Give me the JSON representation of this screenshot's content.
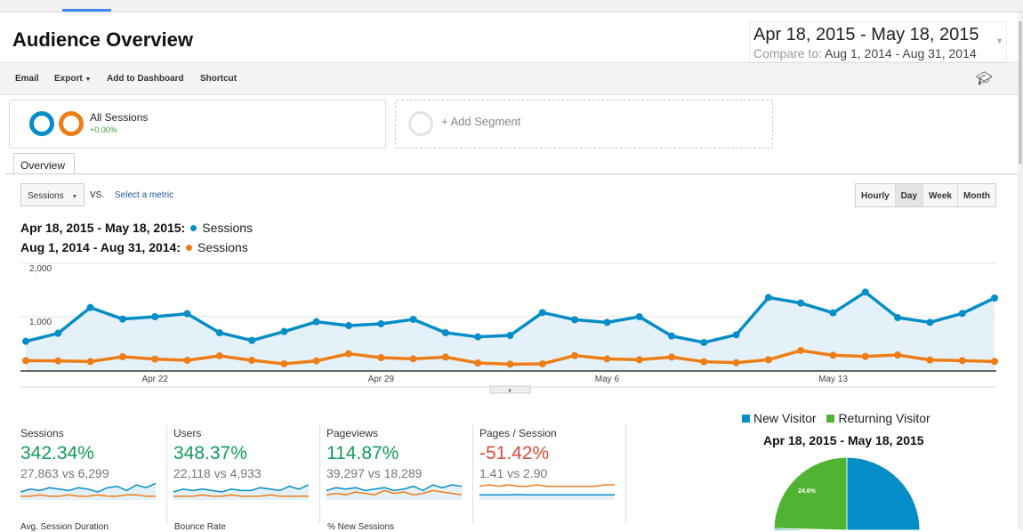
{
  "header": {
    "title": "Audience Overview",
    "date_range": "Apr 18, 2015 - May 18, 2015",
    "compare_label": "Compare to:",
    "compare_range": "Aug 1, 2014 - Aug 31, 2014"
  },
  "toolbar": {
    "email": "Email",
    "export": "Export",
    "add_dashboard": "Add to Dashboard",
    "shortcut": "Shortcut",
    "icon": "graduation-cap-icon"
  },
  "segments": {
    "all_sessions": "All Sessions",
    "all_sessions_change": "+0.00%",
    "add_segment": "+ Add Segment"
  },
  "tabs": [
    "Overview"
  ],
  "controls": {
    "metric": "Sessions",
    "vs": "VS.",
    "select_metric": "Select a metric",
    "granularity": [
      "Hourly",
      "Day",
      "Week",
      "Month"
    ],
    "selected": "Day"
  },
  "legend": [
    {
      "range": "Apr 18, 2015 - May 18, 2015:",
      "metric": "Sessions",
      "color": "#058dc7"
    },
    {
      "range": "Aug 1, 2014 - Aug 31, 2014:",
      "metric": "Sessions",
      "color": "#ed7e17"
    }
  ],
  "chart_data": [
    {
      "type": "line",
      "x_ticks": [
        "Apr 22",
        "Apr 29",
        "May 6",
        "May 13"
      ],
      "y_ticks": [
        "2,000",
        "1,000"
      ],
      "ylim": [
        0,
        2000
      ],
      "grid": true,
      "x": [
        "Apr 18",
        "Apr 19",
        "Apr 20",
        "Apr 21",
        "Apr 22",
        "Apr 23",
        "Apr 24",
        "Apr 25",
        "Apr 26",
        "Apr 27",
        "Apr 28",
        "Apr 29",
        "Apr 30",
        "May 1",
        "May 2",
        "May 3",
        "May 4",
        "May 5",
        "May 6",
        "May 7",
        "May 8",
        "May 9",
        "May 10",
        "May 11",
        "May 12",
        "May 13",
        "May 14",
        "May 15",
        "May 16",
        "May 17",
        "May 18"
      ],
      "series": [
        {
          "name": "Sessions",
          "color": "#058dc7",
          "values": [
            539,
            689,
            1172,
            956,
            1000,
            1056,
            700,
            556,
            722,
            906,
            833,
            867,
            950,
            700,
            622,
            650,
            1078,
            944,
            894,
            1000,
            639,
            517,
            661,
            1361,
            1256,
            1072,
            1461,
            983,
            894,
            1061,
            1350
          ]
        },
        {
          "name": "Sessions",
          "color": "#ed7e17",
          "values": [
            178,
            172,
            161,
            250,
            206,
            183,
            267,
            183,
            117,
            172,
            306,
            233,
            211,
            244,
            133,
            111,
            117,
            272,
            211,
            194,
            244,
            156,
            139,
            194,
            367,
            278,
            256,
            283,
            189,
            178,
            161
          ]
        }
      ]
    },
    {
      "type": "pie",
      "title": "Apr 18, 2015 - May 18, 2015",
      "legend": [
        "New Visitor",
        "Returning Visitor"
      ],
      "values": [
        75.4,
        24.6
      ],
      "colors": [
        "#058dc7",
        "#50b432"
      ],
      "labels": [
        "",
        "24.6%"
      ]
    }
  ],
  "metrics": [
    {
      "name": "Sessions",
      "change": "342.34%",
      "color": "#0f9d58",
      "values": "27,863 vs 6,299",
      "spark_a": [
        5,
        7,
        6,
        8,
        7,
        6,
        8,
        7,
        5,
        8,
        9,
        6,
        10,
        8,
        11
      ],
      "spark_b": [
        2,
        2,
        3,
        2,
        2,
        3,
        2,
        2,
        3,
        2,
        2,
        3,
        3,
        2,
        2
      ]
    },
    {
      "name": "Users",
      "change": "348.37%",
      "color": "#0f9d58",
      "values": "22,118 vs 4,933",
      "spark_a": [
        5,
        7,
        6,
        7,
        6,
        5,
        7,
        6,
        6,
        8,
        7,
        6,
        9,
        7,
        10
      ],
      "spark_b": [
        2,
        2,
        2,
        3,
        2,
        2,
        3,
        2,
        2,
        2,
        3,
        2,
        2,
        2,
        2
      ]
    },
    {
      "name": "Pageviews",
      "change": "114.87%",
      "color": "#0f9d58",
      "values": "39,297 vs 18,289",
      "spark_a": [
        6,
        8,
        7,
        8,
        6,
        7,
        8,
        6,
        7,
        9,
        6,
        10,
        8,
        10,
        9
      ],
      "spark_b": [
        3,
        4,
        3,
        5,
        4,
        3,
        6,
        4,
        5,
        3,
        4,
        6,
        5,
        4,
        3
      ]
    },
    {
      "name": "Pages / Session",
      "change": "-51.42%",
      "color": "#dd4b39",
      "values": "1.41 vs 2.90",
      "spark_a": [
        3,
        3,
        3,
        3,
        3.2,
        3,
        3,
        3,
        3,
        3,
        3,
        3,
        3,
        3,
        3
      ],
      "spark_b": [
        9,
        10,
        9,
        10,
        9,
        9,
        10,
        9,
        9,
        9,
        9,
        9,
        9,
        10,
        10
      ]
    }
  ],
  "metrics_row2": [
    "Avg. Session Duration",
    "Bounce Rate",
    "% New Sessions"
  ]
}
